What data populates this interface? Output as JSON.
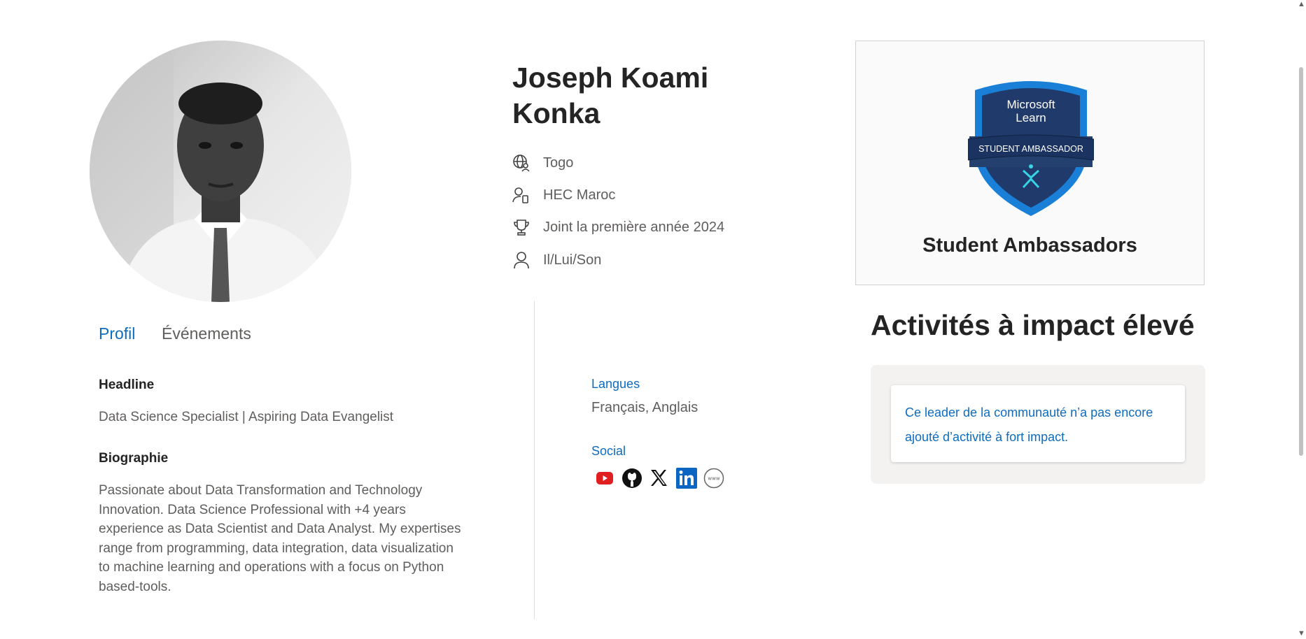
{
  "profile": {
    "name": "Joseph Koami Konka",
    "meta": {
      "country": "Togo",
      "school": "HEC Maroc",
      "joined": "Joint la première année 2024",
      "pronouns": "Il/Lui/Son"
    }
  },
  "tabs": {
    "profil": "Profil",
    "events": "Événements"
  },
  "about": {
    "headline_label": "Headline",
    "headline": "Data Science Specialist | Aspiring Data Evangelist",
    "bio_label": "Biographie",
    "bio_lines": [
      "Passionate about Data Transformation and Technology",
      "Innovation. Data Science Professional with +4 years",
      "experience as Data Scientist and Data Analyst. My expertises",
      "range from programming, data integration, data visualization",
      "to machine learning and operations with a focus on Python",
      "based-tools."
    ]
  },
  "side": {
    "languages_label": "Langues",
    "languages": "Français, Anglais",
    "social_label": "Social",
    "social_icons": [
      "youtube-icon",
      "github-icon",
      "x-icon",
      "linkedin-icon",
      "website-icon"
    ]
  },
  "badge": {
    "brand_line1": "Microsoft",
    "brand_line2": "Learn",
    "ribbon": "STUDENT AMBASSADOR",
    "title": "Student Ambassadors"
  },
  "impact": {
    "title": "Activités à impact élevé",
    "empty_lines": [
      "Ce leader de la communauté n’a pas encore",
      "ajouté d’activité à fort impact."
    ]
  },
  "colors": {
    "accent": "#0f6cbd",
    "text": "#242424",
    "muted": "#605e5c",
    "shield_dark": "#1f3a6b",
    "shield_blue": "#1a7fd6"
  }
}
